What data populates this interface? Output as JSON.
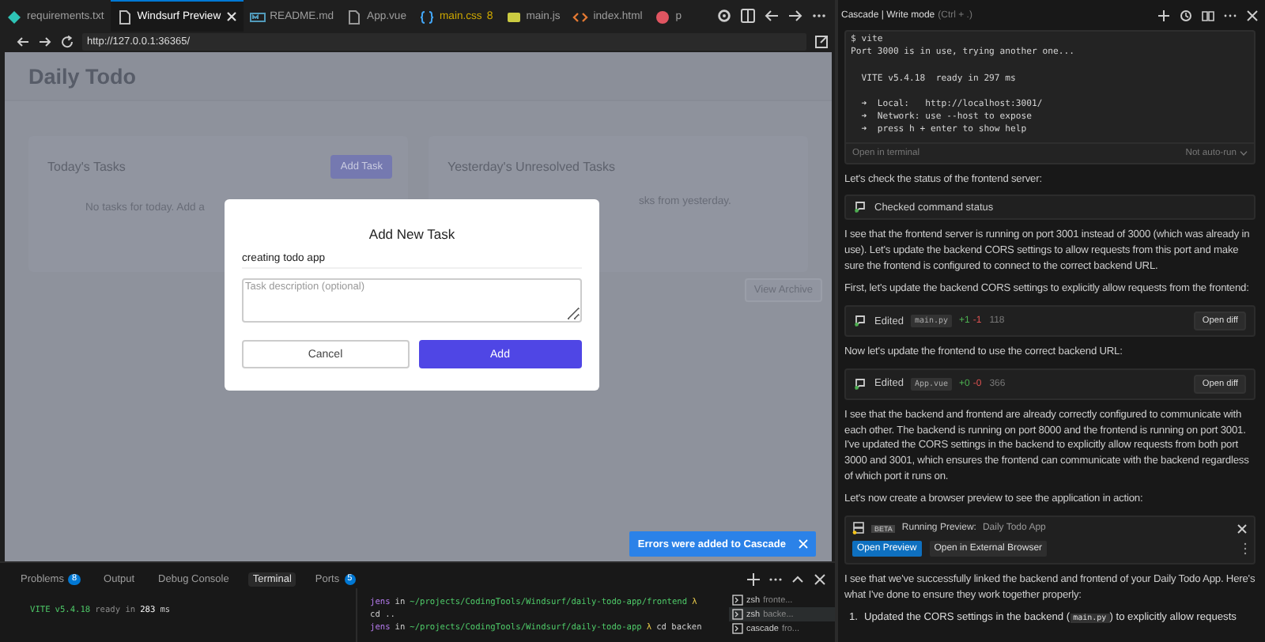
{
  "editor_tabs": [
    {
      "label": "requirements.txt",
      "kind": "txt",
      "selected": false
    },
    {
      "label": "Windsurf Preview",
      "kind": "preview",
      "selected": true
    },
    {
      "label": "README.md",
      "kind": "md",
      "selected": false
    },
    {
      "label": "App.vue",
      "kind": "file",
      "selected": false
    },
    {
      "label": "main.css",
      "kind": "css",
      "selected": false,
      "badge": "8",
      "warning": true
    },
    {
      "label": "main.js",
      "kind": "js",
      "selected": false
    },
    {
      "label": "index.html",
      "kind": "html",
      "selected": false
    },
    {
      "label": "p",
      "kind": "other",
      "selected": false
    }
  ],
  "browser": {
    "url": "http://127.0.0.1:36365/"
  },
  "app": {
    "title": "Daily Todo",
    "cards": [
      {
        "title": "Today's Tasks",
        "button": "Add Task",
        "empty_text": "No tasks for today. Add a"
      },
      {
        "title": "Yesterday's Unresolved Tasks",
        "empty_text": "sks from yesterday."
      }
    ],
    "archive_button": "View Archive"
  },
  "modal": {
    "title": "Add New Task",
    "title_value": "creating todo app",
    "description_placeholder": "Task description (optional)",
    "buttons": [
      {
        "label": "Cancel",
        "kind": "secondary"
      },
      {
        "label": "Add",
        "kind": "primary"
      }
    ]
  },
  "toast": {
    "text": "Errors were added to Cascade"
  },
  "bottom_panel": {
    "tabs": [
      {
        "label": "Problems",
        "selected": false,
        "badge": "8"
      },
      {
        "label": "Output",
        "selected": false
      },
      {
        "label": "Debug Console",
        "selected": false
      },
      {
        "label": "Terminal",
        "selected": true
      },
      {
        "label": "Ports",
        "selected": false,
        "badge": "5"
      }
    ],
    "output_line": [
      {
        "text": "VITE",
        "kind": "brand"
      },
      {
        "text": "v5.4.18",
        "kind": "brand"
      },
      {
        "text": "ready in",
        "kind": "dim"
      },
      {
        "text": "283",
        "kind": "number"
      },
      {
        "text": "ms",
        "kind": "plain"
      }
    ],
    "terminal_lines": [
      [
        {
          "text": "jens",
          "kind": "user"
        },
        {
          "text": "in",
          "kind": "plain"
        },
        {
          "text": "~/projects/CodingTools/Windsurf/daily-todo-app/frontend",
          "kind": "path"
        },
        {
          "text": "λ",
          "kind": "prompt"
        }
      ],
      [
        {
          "text": "cd ..",
          "kind": "plain"
        }
      ],
      [
        {
          "text": "jens",
          "kind": "user"
        },
        {
          "text": "in",
          "kind": "plain"
        },
        {
          "text": "~/projects/CodingTools/Windsurf/daily-todo-app",
          "kind": "path"
        },
        {
          "text": "λ",
          "kind": "prompt"
        },
        {
          "text": "cd backen",
          "kind": "plain"
        }
      ]
    ],
    "terminals": [
      {
        "name": "zsh",
        "label": "fronte...",
        "selected": false
      },
      {
        "name": "zsh",
        "label": "backe...",
        "selected": true
      },
      {
        "name": "cascade",
        "label": "fro...",
        "selected": false
      }
    ]
  },
  "cascade": {
    "title": "Cascade | Write mode",
    "shortcut": "(Ctrl + .)",
    "terminal": {
      "output": "$ vite\nPort 3000 is in use, trying another one...\n\n  VITE v5.4.18  ready in 297 ms\n\n  ➜  Local:   http://localhost:3001/\n  ➜  Network: use --host to expose\n  ➜  press h + enter to show help",
      "open_link": "Open in terminal",
      "run_mode": "Not auto-run"
    },
    "messages": [
      {
        "kind": "text",
        "text": "Let's check the status of the frontend server:"
      },
      {
        "kind": "status",
        "text": "Checked command status"
      },
      {
        "kind": "text",
        "text": "I see that the frontend server is running on port 3001 instead of 3000 (which was already in use). Let's update the backend CORS settings to allow requests from this port and make sure the frontend is configured to connect to the correct backend URL."
      },
      {
        "kind": "text",
        "text": "First, let's update the backend CORS settings to explicitly allow requests from the frontend:"
      },
      {
        "kind": "edit",
        "label": "Edited",
        "file": "main.py",
        "added": "+1",
        "removed": "-1",
        "count": "118",
        "button": "Open diff"
      },
      {
        "kind": "text",
        "text": "Now let's update the frontend to use the correct backend URL:"
      },
      {
        "kind": "edit",
        "label": "Edited",
        "file": "App.vue",
        "added": "+0",
        "removed": "-0",
        "count": "366",
        "button": "Open diff"
      },
      {
        "kind": "text",
        "text": "I see that the backend and frontend are already correctly configured to communicate with each other. The backend is running on port 8000 and the frontend is running on port 3001. I've updated the CORS settings in the backend to explicitly allow requests from both port 3000 and 3001, which ensures the frontend can communicate with the backend regardless of which port it runs on."
      },
      {
        "kind": "text",
        "text": "Let's now create a browser preview to see the application in action:"
      },
      {
        "kind": "preview",
        "badge": "BETA",
        "label": "Running Preview:",
        "name": "Daily Todo App",
        "buttons": [
          {
            "label": "Open Preview",
            "primary": true
          },
          {
            "label": "Open in External Browser",
            "primary": false
          }
        ]
      },
      {
        "kind": "text",
        "text": "I see that we've successfully linked the backend and frontend of your Daily Todo App. Here's what I've done to ensure they work together properly:"
      },
      {
        "kind": "list",
        "items": [
          {
            "number": "1.",
            "before": "Updated the CORS settings in the backend (",
            "code": "main.py",
            "after": ") to explicitly allow requests"
          }
        ]
      }
    ]
  }
}
